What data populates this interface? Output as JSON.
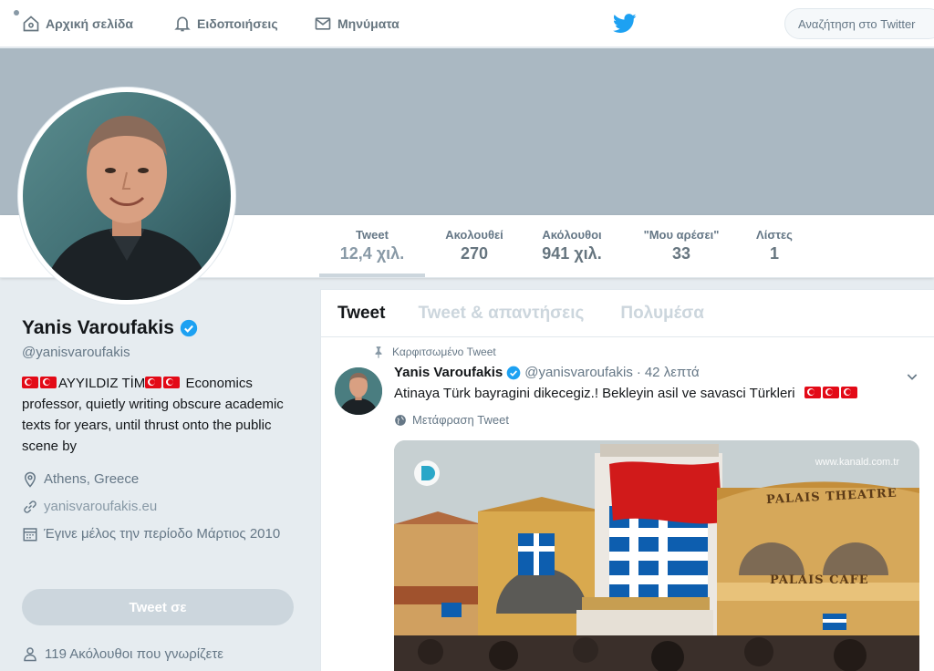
{
  "nav": {
    "home_label": "Αρχική σελίδα",
    "notifications_label": "Ειδοποιήσεις",
    "messages_label": "Μηνύματα",
    "search_placeholder": "Αναζήτηση στο Twitter"
  },
  "stats": [
    {
      "label": "Tweet",
      "value": "12,4 χιλ."
    },
    {
      "label": "Ακολουθεί",
      "value": "270"
    },
    {
      "label": "Ακόλουθοι",
      "value": "941 χιλ."
    },
    {
      "label": "\"Μου αρέσει\"",
      "value": "33"
    },
    {
      "label": "Λίστες",
      "value": "1"
    }
  ],
  "profile": {
    "name": "Yanis Varoufakis",
    "handle": "@yanisvaroufakis",
    "bio_highlight": "AYYILDIZ TİM",
    "bio_text": " Economics professor, quietly writing obscure academic texts for years, until thrust onto the public scene by",
    "location": "Athens, Greece",
    "website": "yanisvaroufakis.eu",
    "joined": "Έγινε μέλος την περίοδο Μάρτιος 2010",
    "tweet_to_label": "Tweet σε",
    "followers_you_know": "119 Ακόλουθοι που γνωρίζετε"
  },
  "timeline": {
    "tabs": [
      "Tweet",
      "Tweet & απαντήσεις",
      "Πολυμέσα"
    ],
    "tweet": {
      "pinned_label": "Καρφιτσωμένο Tweet",
      "name": "Yanis Varoufakis",
      "handle": "@yanisvaroufakis",
      "dot": "·",
      "time": "42 λεπτά",
      "text": "Atinaya Türk bayragini dikecegiz.! Bekleyin asil ve savasci Türkleri",
      "translate_label": "Μετάφραση Tweet",
      "media_watermark": "www.kanald.com.tr",
      "media_sign": "PALAIS THEATRE",
      "media_sign2": "PALAIS CAFE"
    }
  },
  "colors": {
    "accent": "#1da1f2",
    "banner": "#aab8c2",
    "turkish_red": "#e30a17",
    "greek_blue": "#0d5eaf"
  }
}
